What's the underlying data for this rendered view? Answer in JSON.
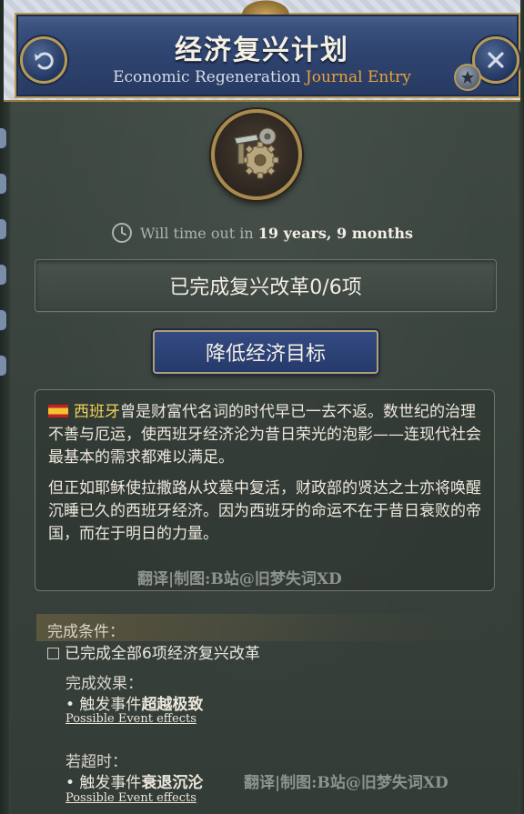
{
  "header": {
    "title": "经济复兴计划",
    "subtitle_main": "Economic Regeneration ",
    "subtitle_accent": "Journal Entry"
  },
  "icons": {
    "back": "back-arrow-icon",
    "close": "close-icon",
    "pin": "star-icon",
    "emblem": "gears-machinery-icon",
    "clock": "clock-icon",
    "flag": "spain-flag-icon"
  },
  "timeout": {
    "prefix": "Will time out in ",
    "value": "19 years, 9 months"
  },
  "progress": {
    "text": "已完成复兴改革0/6项"
  },
  "action_button": {
    "label": "降低经济目标"
  },
  "description": {
    "country": "西班牙",
    "paragraph1_rest": "曾是财富代名词的时代早已一去不返。数世纪的治理不善与厄运，使西班牙经济沦为昔日荣光的泡影——连现代社会最基本的需求都难以满足。",
    "paragraph2": "但正如耶稣使拉撒路从坟墓中复活，财政部的贤达之士亦将唤醒沉睡已久的西班牙经济。因为西班牙的命运不在于昔日衰败的帝国，而在于明日的力量。"
  },
  "watermarks": {
    "w1": "翻译|制图:B站@旧梦失词XD",
    "w2": "翻译|制图:B站@旧梦失词XD"
  },
  "completion": {
    "header": "完成条件：",
    "requirement": "已完成全部6项经济复兴改革",
    "effects_header": "完成效果：",
    "effect_line": "• 触发事件",
    "effect_event": "超越极致",
    "effects_link": "Possible Event effects"
  },
  "timeout_section": {
    "header": "若超时：",
    "effect_line": "• 触发事件",
    "effect_event": "衰退沉沦",
    "effects_link": "Possible Event effects"
  },
  "colors": {
    "accent_orange": "#e9a23a",
    "country_yellow": "#f1d35b",
    "header_blue": "#2f4470",
    "gold_border": "#b89a55"
  }
}
